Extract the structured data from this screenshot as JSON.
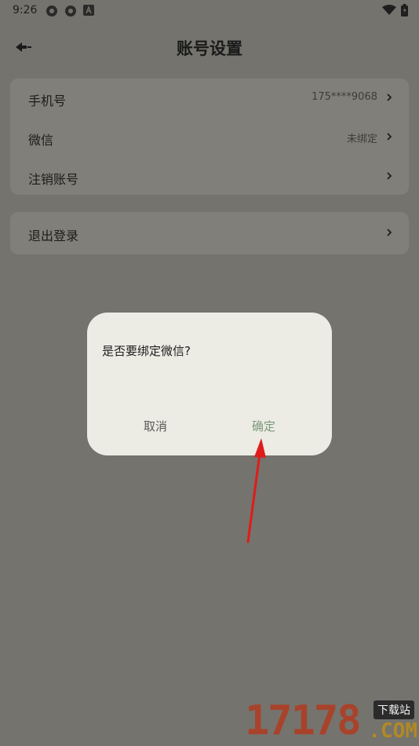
{
  "status_bar": {
    "time": "9:26",
    "icons": [
      "app-icon",
      "app-icon",
      "a-icon"
    ],
    "right_icons": [
      "wifi-icon",
      "battery-icon"
    ]
  },
  "header": {
    "title": "账号设置",
    "back_icon": "back-arrow-icon"
  },
  "account_list": [
    {
      "label": "手机号",
      "value": "175****9068"
    },
    {
      "label": "微信",
      "value": "未绑定"
    },
    {
      "label": "注销账号",
      "value": ""
    }
  ],
  "logout": {
    "label": "退出登录"
  },
  "dialog": {
    "message": "是否要绑定微信?",
    "cancel_label": "取消",
    "confirm_label": "确定"
  },
  "annotation": {
    "color": "#e01b1b"
  },
  "watermark": {
    "numbers": "17178",
    "badge": "下载站",
    "domain": ".COM"
  },
  "colors": {
    "background": "#74736d",
    "card": "#807f79",
    "dialog": "#ecebe4",
    "confirm_text": "#7a9a7c"
  }
}
